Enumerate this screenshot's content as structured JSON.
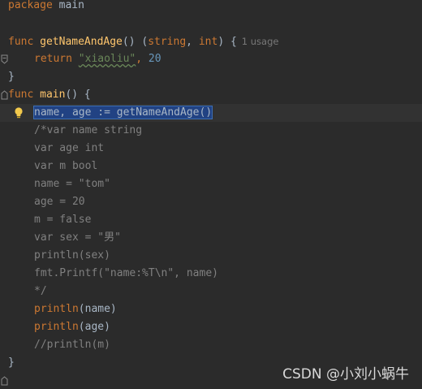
{
  "editor": {
    "lines": {
      "l1": {
        "kw": "package",
        "name": "main"
      },
      "l3": {
        "kw": "func",
        "fn": "getNameAndAge",
        "params": "() (",
        "t1": "string",
        "sep": ",",
        "t2": "int",
        "close": ") {",
        "usage": "1 usage"
      },
      "l4": {
        "kw": "return",
        "str": "\"xiaoliu\"",
        "comma": ",",
        "num": "20"
      },
      "l5": {
        "text": "}"
      },
      "l6": {
        "kw": "func",
        "fn": "main",
        "rest": "() {"
      },
      "l7": {
        "text": "name, age := getNameAndAge()"
      },
      "l8": "/*var name string",
      "l9": "var age int",
      "l10": "var m bool",
      "l11": "name = \"tom\"",
      "l12": "age = 20",
      "l13": "m = false",
      "l14": "var sex = \"男\"",
      "l15": "println(sex)",
      "l16": "fmt.Printf(\"name:%T\\n\", name)",
      "l17": "*/",
      "l18": {
        "fn": "println",
        "arg": "(name)"
      },
      "l19": {
        "fn": "println",
        "arg": "(age)"
      },
      "l20": "//println(m)",
      "l21": {
        "text": "}"
      }
    }
  },
  "watermark": "CSDN @小刘小蜗牛",
  "colors": {
    "background": "#2b2b2b",
    "keyword": "#cc7832",
    "function": "#ffc66d",
    "string": "#6a8759",
    "number": "#6897bb",
    "comment": "#808080",
    "selection": "#214283"
  },
  "icons": {
    "intention": "lightbulb-icon",
    "fold": "fold-marker-icon"
  }
}
